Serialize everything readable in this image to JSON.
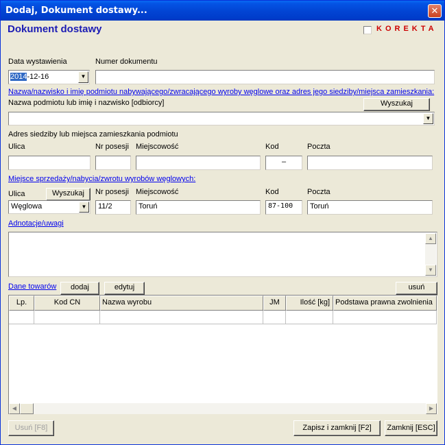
{
  "window": {
    "title": "Dodaj, Dokument dostawy...",
    "close_glyph": "✕"
  },
  "header": {
    "title": "Dokument dostawy",
    "korekta_label": "KOREKTA",
    "korekta_checked": false
  },
  "doc": {
    "date_label": "Data wystawienia",
    "date_selected": "2014",
    "date_rest": "-12-16",
    "number_label": "Numer dokumentu",
    "number_value": ""
  },
  "buyer": {
    "section_link": "Nazwa/nazwisko i imię podmiotu nabywającego/zwracającego wyroby węglowe oraz adres jego siedziby/miejsca zamieszkania:",
    "name_label": "Nazwa podmiotu lub imię i nazwisko [odbiorcy]",
    "search_button": "Wyszukaj",
    "name_value": "",
    "address_label": "Adres siedziby lub miejsca zamieszkania podmiotu",
    "street_label": "Ulica",
    "house_label": "Nr posesji",
    "city_label": "Miejscowość",
    "zip_label": "Kod",
    "post_label": "Poczta",
    "street_value": "",
    "house_value": "",
    "city_value": "",
    "zip_value": "–",
    "post_value": ""
  },
  "place": {
    "section_link": "Miejsce sprzedaży/nabycia/zwrotu wyrobów węglowych:",
    "street_label": "Ulica",
    "search_button": "Wyszukaj",
    "house_label": "Nr posesji",
    "city_label": "Miejscowość",
    "zip_label": "Kod",
    "post_label": "Poczta",
    "street_value": "Węglowa",
    "house_value": "11/2",
    "city_value": "Toruń",
    "zip_value": "87-100",
    "post_value": "Toruń"
  },
  "notes": {
    "link": "Adnotacje/uwagi",
    "value": ""
  },
  "goods": {
    "link": "Dane towarów",
    "add_button": "dodaj",
    "edit_button": "edytuj",
    "remove_button": "usuń",
    "columns": [
      "Lp.",
      "Kod CN",
      "Nazwa wyrobu",
      "JM",
      "Ilość [kg]",
      "Podstawa prawna zwolnienia"
    ]
  },
  "footer": {
    "delete_button": "Usuń [F8]",
    "save_button": "Zapisz i zamknij [F2]",
    "close_button": "Zamknij [ESC]"
  },
  "icons": {
    "dropdown": "chevron-down-icon",
    "scroll_up": "arrow-up-icon",
    "scroll_down": "arrow-down-icon",
    "scroll_left": "arrow-left-icon",
    "scroll_right": "arrow-right-icon"
  },
  "colors": {
    "title_bar": "#0244d3",
    "header_title": "#1c1cb4",
    "korekta": "#cc0000",
    "link": "#0000ee",
    "selection": "#316ac5",
    "dialog_bg": "#ece9d8"
  }
}
